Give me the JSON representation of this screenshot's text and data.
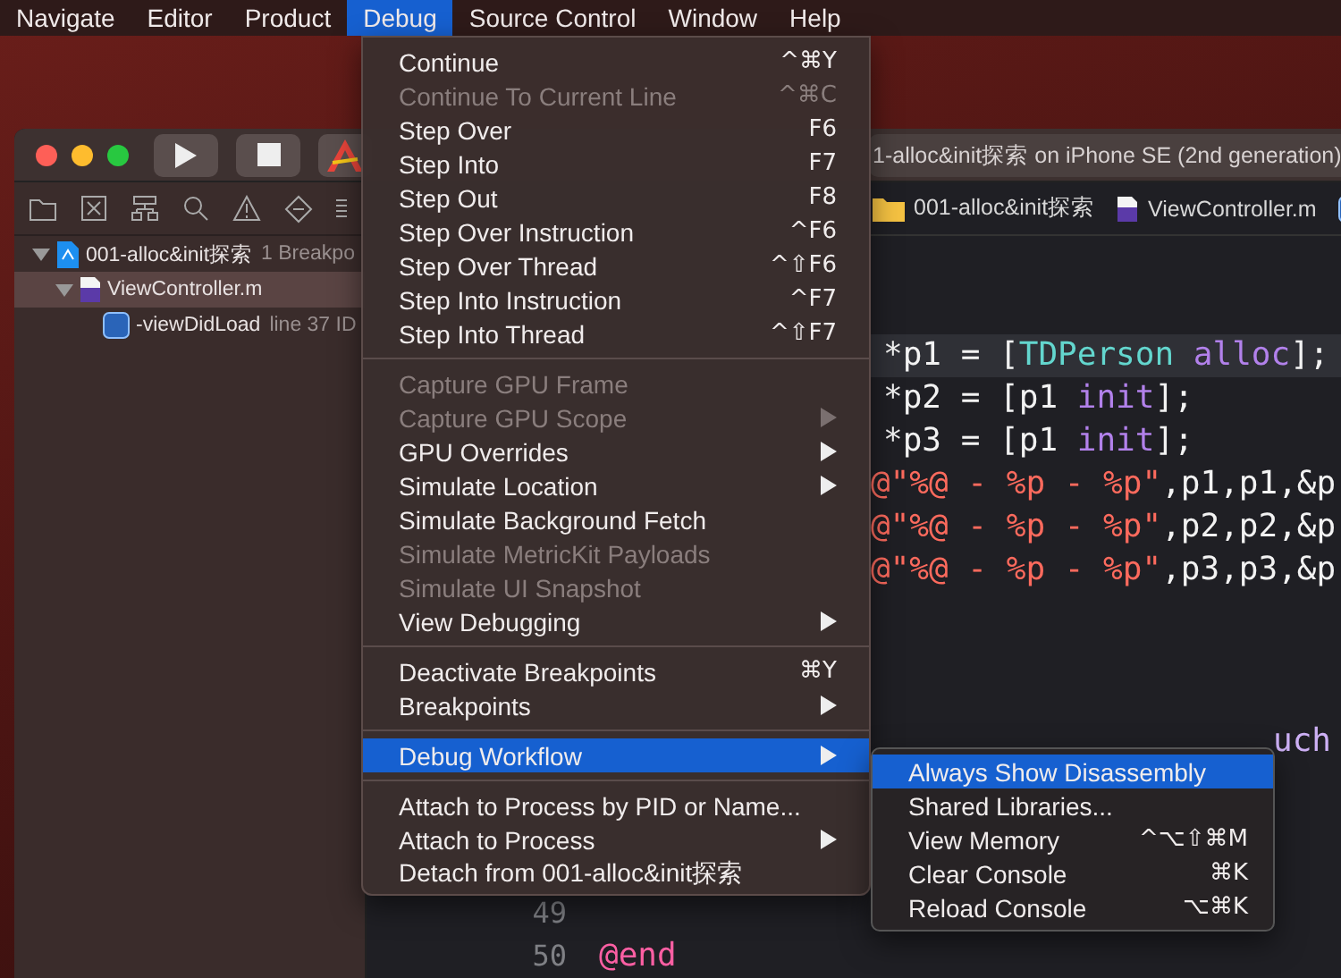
{
  "menu_bar": [
    {
      "label": "Navigate",
      "selected": false
    },
    {
      "label": "Editor",
      "selected": false
    },
    {
      "label": "Product",
      "selected": false
    },
    {
      "label": "Debug",
      "selected": true
    },
    {
      "label": "Source Control",
      "selected": false
    },
    {
      "label": "Window",
      "selected": false
    },
    {
      "label": "Help",
      "selected": false
    }
  ],
  "xcode_window": {
    "status": "1-alloc&init探索 on iPhone SE (2nd generation)",
    "navigator": [
      {
        "label": "001-alloc&init探索",
        "detail": "1 Breakpo",
        "kind": "project",
        "expanded": true,
        "selected": false,
        "children": [
          {
            "label": "ViewController.m",
            "kind": "source",
            "expanded": true,
            "selected": true,
            "children": [
              {
                "label": "-viewDidLoad",
                "detail": "line 37 ID",
                "kind": "method",
                "expanded": false,
                "selected": false
              }
            ]
          }
        ]
      }
    ],
    "jump_bar": [
      {
        "label": "001-alloc&init探索",
        "kind": "folder"
      },
      {
        "label": "ViewController.m",
        "kind": "source"
      },
      {
        "kind": "method"
      }
    ],
    "code_lines": [
      {
        "kind": "pointer",
        "highlighted": true,
        "tokens": [
          {
            "text": "*p1 = [",
            "kind": "plain"
          },
          {
            "text": "TDPerson",
            "kind": "class"
          },
          {
            "text": " alloc",
            "kind": "method"
          },
          {
            "text": "];",
            "kind": "plain"
          }
        ]
      },
      {
        "kind": "pointer",
        "tokens": [
          {
            "text": "*p2 = [p1 ",
            "kind": "plain"
          },
          {
            "text": "init",
            "kind": "method"
          },
          {
            "text": "];",
            "kind": "plain"
          }
        ]
      },
      {
        "kind": "pointer",
        "tokens": [
          {
            "text": "*p3 = [p1 ",
            "kind": "plain"
          },
          {
            "text": "init",
            "kind": "method"
          },
          {
            "text": "];",
            "kind": "plain"
          }
        ]
      },
      {
        "kind": "log",
        "tokens": [
          {
            "text": "@\"%@ - %p - %p\"",
            "kind": "string"
          },
          {
            "text": ",p1,p1,&p",
            "kind": "plain"
          }
        ]
      },
      {
        "kind": "log",
        "tokens": [
          {
            "text": "@\"%@ - %p - %p\"",
            "kind": "string"
          },
          {
            "text": ",p2,p2,&p",
            "kind": "plain"
          }
        ]
      },
      {
        "kind": "log",
        "tokens": [
          {
            "text": "@\"%@ - %p - %p\"",
            "kind": "string"
          },
          {
            "text": ",p3,p3,&p",
            "kind": "plain"
          }
        ]
      },
      {
        "kind": "blank"
      },
      {
        "kind": "blank"
      },
      {
        "kind": "blank"
      },
      {
        "kind": "signature",
        "tokens": [
          {
            "text": "uch",
            "kind": "type"
          }
        ]
      },
      {
        "kind": "blank"
      },
      {
        "kind": "blank"
      },
      {
        "kind": "blank"
      },
      {
        "kind": "numbered",
        "number": "49"
      },
      {
        "kind": "numbered",
        "number": "50",
        "tokens": [
          {
            "text": "@end",
            "kind": "keyword"
          }
        ]
      }
    ]
  },
  "debug_menu": {
    "groups": [
      [
        {
          "label": "Continue",
          "shortcut": "^⌘Y",
          "submenu": false,
          "disabled": false,
          "selected": false
        },
        {
          "label": "Continue To Current Line",
          "shortcut": "^⌘C",
          "submenu": false,
          "disabled": true,
          "selected": false
        },
        {
          "label": "Step Over",
          "shortcut": "F6",
          "submenu": false,
          "disabled": false,
          "selected": false
        },
        {
          "label": "Step Into",
          "shortcut": "F7",
          "submenu": false,
          "disabled": false,
          "selected": false
        },
        {
          "label": "Step Out",
          "shortcut": "F8",
          "submenu": false,
          "disabled": false,
          "selected": false
        },
        {
          "label": "Step Over Instruction",
          "shortcut": "^F6",
          "submenu": false,
          "disabled": false,
          "selected": false
        },
        {
          "label": "Step Over Thread",
          "shortcut": "^⇧F6",
          "submenu": false,
          "disabled": false,
          "selected": false
        },
        {
          "label": "Step Into Instruction",
          "shortcut": "^F7",
          "submenu": false,
          "disabled": false,
          "selected": false
        },
        {
          "label": "Step Into Thread",
          "shortcut": "^⇧F7",
          "submenu": false,
          "disabled": false,
          "selected": false
        }
      ],
      [
        {
          "label": "Capture GPU Frame",
          "submenu": false,
          "disabled": true,
          "selected": false
        },
        {
          "label": "Capture GPU Scope",
          "submenu": true,
          "disabled": true,
          "selected": false
        },
        {
          "label": "GPU Overrides",
          "submenu": true,
          "disabled": false,
          "selected": false
        },
        {
          "label": "Simulate Location",
          "submenu": true,
          "disabled": false,
          "selected": false
        },
        {
          "label": "Simulate Background Fetch",
          "submenu": false,
          "disabled": false,
          "selected": false
        },
        {
          "label": "Simulate MetricKit Payloads",
          "submenu": false,
          "disabled": true,
          "selected": false
        },
        {
          "label": "Simulate UI Snapshot",
          "submenu": false,
          "disabled": true,
          "selected": false
        },
        {
          "label": "View Debugging",
          "submenu": true,
          "disabled": false,
          "selected": false
        }
      ],
      [
        {
          "label": "Deactivate Breakpoints",
          "shortcut": "⌘Y",
          "submenu": false,
          "disabled": false,
          "selected": false
        },
        {
          "label": "Breakpoints",
          "submenu": true,
          "disabled": false,
          "selected": false
        }
      ],
      [
        {
          "label": "Debug Workflow",
          "submenu": true,
          "disabled": false,
          "selected": true
        }
      ],
      [
        {
          "label": "Attach to Process by PID or Name...",
          "submenu": false,
          "disabled": false,
          "selected": false
        },
        {
          "label": "Attach to Process",
          "submenu": true,
          "disabled": false,
          "selected": false
        },
        {
          "label": "Detach from 001-alloc&init探索",
          "submenu": false,
          "disabled": false,
          "selected": false
        }
      ]
    ]
  },
  "debug_workflow_submenu": {
    "items": [
      {
        "label": "Always Show Disassembly",
        "selected": true
      },
      {
        "label": "Shared Libraries...",
        "selected": false
      },
      {
        "label": "View Memory",
        "shortcut": "^⌥⇧⌘M",
        "selected": false
      },
      {
        "label": "Clear Console",
        "shortcut": "⌘K",
        "selected": false
      },
      {
        "label": "Reload Console",
        "shortcut": "⌥⌘K",
        "selected": false
      }
    ]
  }
}
